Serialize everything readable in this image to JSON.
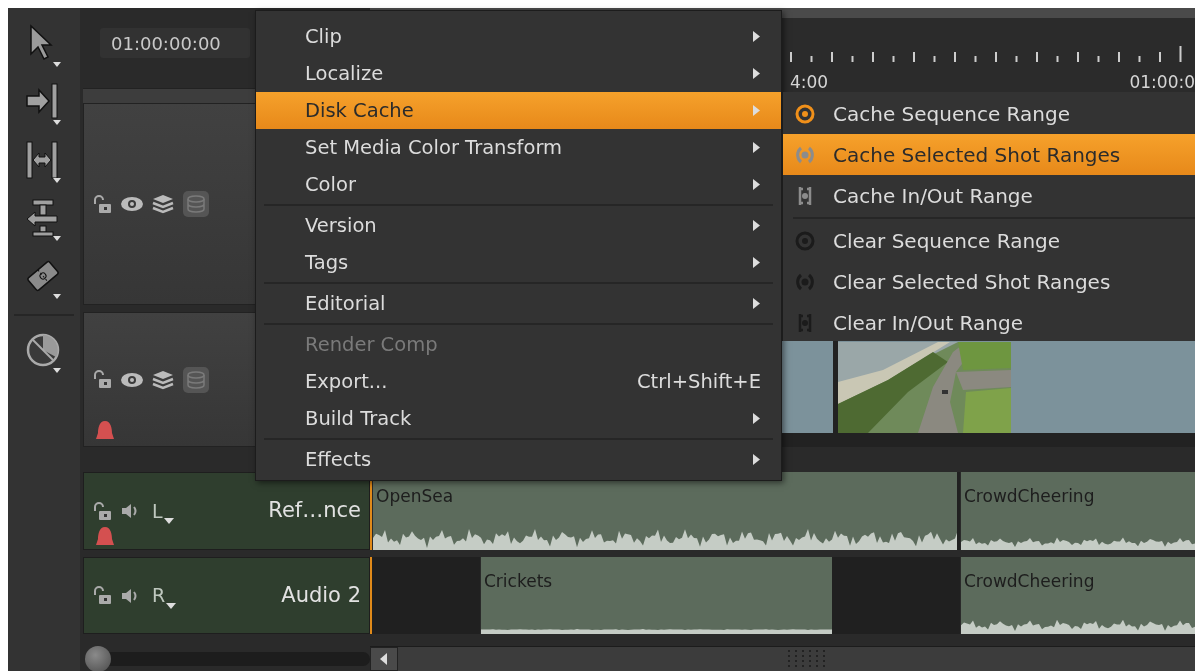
{
  "timecode": "01:00:00:00",
  "ruler": {
    "labels": [
      "4:00",
      "01:00:0"
    ]
  },
  "video_tracks": [
    {
      "tagged": false
    },
    {
      "tagged": true
    }
  ],
  "audio_tracks": [
    {
      "channel": "L",
      "name": "Ref…nce",
      "tagged": true,
      "clips": [
        {
          "name": "OpenSea"
        },
        {
          "name": "CrowdCheering"
        }
      ]
    },
    {
      "channel": "R",
      "name": "Audio 2",
      "tagged": false,
      "clips": [
        {
          "name": "Crickets"
        },
        {
          "name": "CrowdCheering"
        }
      ]
    }
  ],
  "context_menu": {
    "items": [
      {
        "kind": "item",
        "label": "Clip",
        "submenu": true,
        "selected": false,
        "disabled": false
      },
      {
        "kind": "item",
        "label": "Localize",
        "submenu": true,
        "selected": false,
        "disabled": false
      },
      {
        "kind": "item",
        "label": "Disk Cache",
        "submenu": true,
        "selected": true,
        "disabled": false
      },
      {
        "kind": "item",
        "label": "Set Media Color Transform",
        "submenu": true,
        "selected": false,
        "disabled": false
      },
      {
        "kind": "item",
        "label": "Color",
        "submenu": true,
        "selected": false,
        "disabled": false
      },
      {
        "kind": "separator"
      },
      {
        "kind": "item",
        "label": "Version",
        "submenu": true,
        "selected": false,
        "disabled": false
      },
      {
        "kind": "item",
        "label": "Tags",
        "submenu": true,
        "selected": false,
        "disabled": false
      },
      {
        "kind": "separator"
      },
      {
        "kind": "item",
        "label": "Editorial",
        "submenu": true,
        "selected": false,
        "disabled": false
      },
      {
        "kind": "separator"
      },
      {
        "kind": "item",
        "label": "Render Comp",
        "submenu": false,
        "selected": false,
        "disabled": true
      },
      {
        "kind": "item",
        "label": "Export...",
        "shortcut": "Ctrl+Shift+E",
        "submenu": false,
        "selected": false,
        "disabled": false
      },
      {
        "kind": "item",
        "label": "Build Track",
        "submenu": true,
        "selected": false,
        "disabled": false
      },
      {
        "kind": "separator"
      },
      {
        "kind": "item",
        "label": "Effects",
        "submenu": true,
        "selected": false,
        "disabled": false
      }
    ]
  },
  "submenu": {
    "items": [
      {
        "kind": "sequence",
        "active": true,
        "label": "Cache Sequence Range",
        "selected": false
      },
      {
        "kind": "shots",
        "active": false,
        "label": "Cache Selected Shot Ranges",
        "selected": true
      },
      {
        "kind": "inout",
        "active": false,
        "label": "Cache In/Out Range",
        "selected": false
      },
      {
        "kind": "separator"
      },
      {
        "kind": "sequence",
        "active": false,
        "label": "Clear Sequence Range",
        "selected": false
      },
      {
        "kind": "shots",
        "active": false,
        "label": "Clear Selected Shot Ranges",
        "selected": false
      },
      {
        "kind": "inout",
        "active": false,
        "label": "Clear In/Out Range",
        "selected": false
      }
    ]
  }
}
